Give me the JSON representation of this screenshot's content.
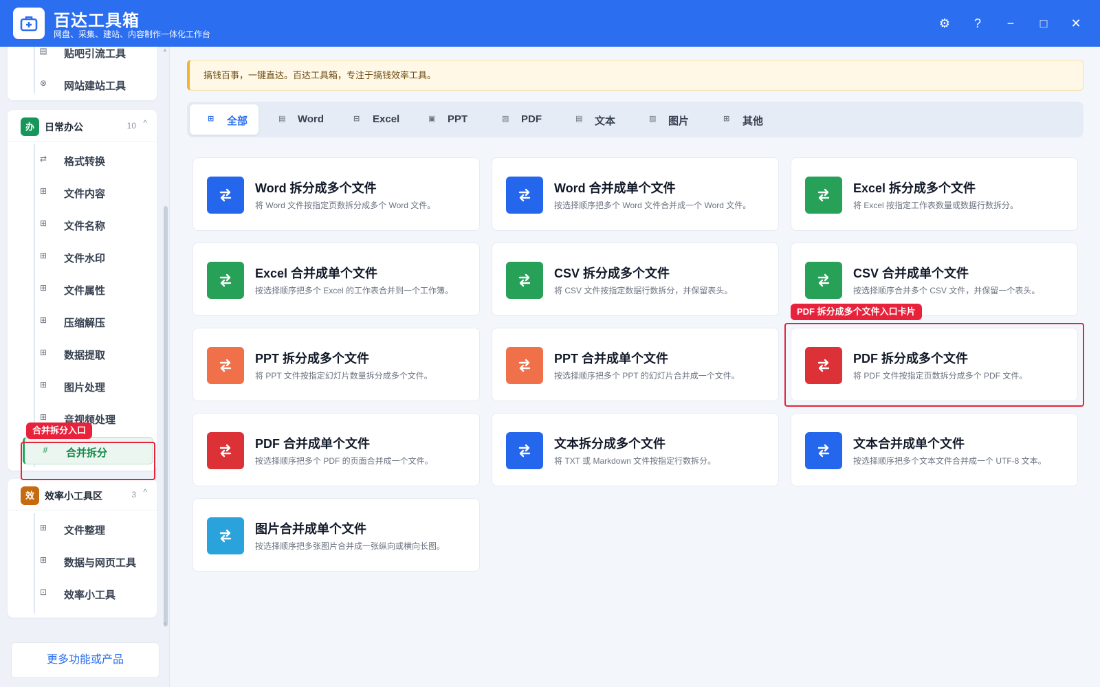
{
  "app": {
    "title": "百达工具箱",
    "subtitle": "网盘、采集、建站、内容制作一体化工作台"
  },
  "window_controls": {
    "settings": "⚙",
    "help": "?",
    "minimize": "−",
    "maximize": "□",
    "close": "✕"
  },
  "sidebar": {
    "top_items": [
      {
        "label": "贴吧引流工具",
        "icon": "list-icon",
        "glyph": "▤"
      },
      {
        "label": "网站建站工具",
        "icon": "globe-icon",
        "glyph": "⊗"
      }
    ],
    "groups": [
      {
        "badge": "办",
        "badge_color": "#16965a",
        "title": "日常办公",
        "count": "10",
        "caret": "^",
        "items": [
          {
            "label": "格式转换",
            "icon": "swap-icon",
            "glyph": "⇄"
          },
          {
            "label": "文件内容",
            "icon": "grid-icon",
            "glyph": "⊞"
          },
          {
            "label": "文件名称",
            "icon": "grid-icon",
            "glyph": "⊞"
          },
          {
            "label": "文件水印",
            "icon": "grid-icon",
            "glyph": "⊞"
          },
          {
            "label": "文件属性",
            "icon": "grid-icon",
            "glyph": "⊞"
          },
          {
            "label": "压缩解压",
            "icon": "grid-icon",
            "glyph": "⊞"
          },
          {
            "label": "数据提取",
            "icon": "grid-icon",
            "glyph": "⊞"
          },
          {
            "label": "图片处理",
            "icon": "grid-icon",
            "glyph": "⊞"
          },
          {
            "label": "音视频处理",
            "icon": "grid-icon",
            "glyph": "⊞"
          },
          {
            "label": "合并拆分",
            "icon": "hash-icon",
            "glyph": "#"
          }
        ]
      },
      {
        "badge": "效",
        "badge_color": "#c56a0e",
        "title": "效率小工具区",
        "count": "3",
        "caret": "^",
        "items": [
          {
            "label": "文件整理",
            "icon": "grid-icon",
            "glyph": "⊞"
          },
          {
            "label": "数据与网页工具",
            "icon": "grid-icon",
            "glyph": "⊞"
          },
          {
            "label": "效率小工具",
            "icon": "toolbox-icon",
            "glyph": "⊡"
          }
        ]
      }
    ],
    "more_button": "更多功能或产品",
    "annotation": "合并拆分入口"
  },
  "notice": "搞钱百事，一键直达。百达工具箱，专注于搞钱效率工具。",
  "tabs": [
    {
      "label": "全部",
      "glyph": "⊞",
      "active": true
    },
    {
      "label": "Word",
      "glyph": "▤",
      "active": false
    },
    {
      "label": "Excel",
      "glyph": "⊟",
      "active": false
    },
    {
      "label": "PPT",
      "glyph": "▣",
      "active": false
    },
    {
      "label": "PDF",
      "glyph": "▧",
      "active": false
    },
    {
      "label": "文本",
      "glyph": "▤",
      "active": false
    },
    {
      "label": "图片",
      "glyph": "▨",
      "active": false
    },
    {
      "label": "其他",
      "glyph": "⊞",
      "active": false
    }
  ],
  "cards": [
    {
      "title": "Word 拆分成多个文件",
      "desc": "将 Word 文件按指定页数拆分成多个 Word 文件。",
      "color": "#2467ec"
    },
    {
      "title": "Word 合并成单个文件",
      "desc": "按选择顺序把多个 Word 文件合并成一个 Word 文件。",
      "color": "#2467ec"
    },
    {
      "title": "Excel 拆分成多个文件",
      "desc": "将 Excel 按指定工作表数量或数据行数拆分。",
      "color": "#27a058"
    },
    {
      "title": "Excel 合并成单个文件",
      "desc": "按选择顺序把多个 Excel 的工作表合并到一个工作簿。",
      "color": "#27a058"
    },
    {
      "title": "CSV 拆分成多个文件",
      "desc": "将 CSV 文件按指定数据行数拆分，并保留表头。",
      "color": "#27a058"
    },
    {
      "title": "CSV 合并成单个文件",
      "desc": "按选择顺序合并多个 CSV 文件，并保留一个表头。",
      "color": "#27a058"
    },
    {
      "title": "PPT 拆分成多个文件",
      "desc": "将 PPT 文件按指定幻灯片数量拆分成多个文件。",
      "color": "#f0704a"
    },
    {
      "title": "PPT 合并成单个文件",
      "desc": "按选择顺序把多个 PPT 的幻灯片合并成一个文件。",
      "color": "#f0704a"
    },
    {
      "title": "PDF 拆分成多个文件",
      "desc": "将 PDF 文件按指定页数拆分成多个 PDF 文件。",
      "color": "#dc3136"
    },
    {
      "title": "PDF 合并成单个文件",
      "desc": "按选择顺序把多个 PDF 的页面合并成一个文件。",
      "color": "#dc3136"
    },
    {
      "title": "文本拆分成多个文件",
      "desc": "将 TXT 或 Markdown 文件按指定行数拆分。",
      "color": "#2467ec"
    },
    {
      "title": "文本合并成单个文件",
      "desc": "按选择顺序把多个文本文件合并成一个 UTF-8 文本。",
      "color": "#2467ec"
    },
    {
      "title": "图片合并成单个文件",
      "desc": "按选择顺序把多张图片合并成一张纵向或横向长图。",
      "color": "#2aa3dc"
    }
  ],
  "card_annotation": "PDF 拆分成多个文件入口卡片"
}
